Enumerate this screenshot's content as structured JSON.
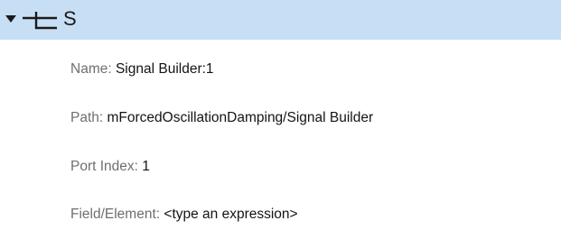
{
  "signal": {
    "expanded": true,
    "icon": "signal-line-icon",
    "name": "S"
  },
  "properties": {
    "name": {
      "label": "Name: ",
      "value": "Signal Builder:1"
    },
    "path": {
      "label": "Path: ",
      "value": "mForcedOscillationDamping/Signal Builder"
    },
    "port_index": {
      "label": "Port Index: ",
      "value": "1"
    },
    "field_element": {
      "label": "Field/Element: ",
      "value": "<type an expression>"
    }
  },
  "colors": {
    "header_background": "#c7dff5",
    "label_text": "#6f6f6f",
    "value_text": "#141414"
  }
}
